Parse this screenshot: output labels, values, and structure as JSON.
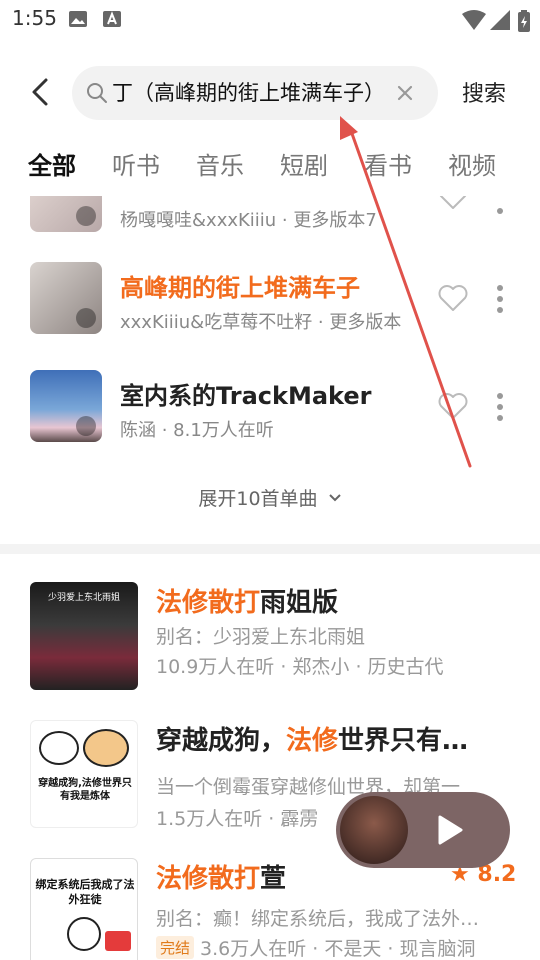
{
  "status_bar": {
    "time": "1:55",
    "icons": [
      "image-icon",
      "a-box-icon",
      "wifi-icon",
      "signal-icon",
      "battery-icon"
    ]
  },
  "search": {
    "query": "丁（高峰期的街上堆满车子）",
    "button_label": "搜索"
  },
  "tabs": [
    {
      "label": "全部",
      "active": true
    },
    {
      "label": "听书"
    },
    {
      "label": "音乐"
    },
    {
      "label": "短剧"
    },
    {
      "label": "看书"
    },
    {
      "label": "视频"
    }
  ],
  "songs": [
    {
      "title": "",
      "subtitle": "杨嘎嘎哇&xxxKiiiu · 更多版本7"
    },
    {
      "title": "高峰期的街上堆满车子",
      "subtitle": "xxxKiiiu&吃草莓不吐籽 · 更多版本",
      "highlight": true
    },
    {
      "title": "室内系的TrackMaker",
      "subtitle": "陈涵 · 8.1万人在听"
    }
  ],
  "expand_label": "展开10首单曲",
  "books": [
    {
      "title_hl": "法修散打",
      "title_rest": "雨姐版",
      "line1": "别名：少羽爱上东北雨姐",
      "line2": "10.9万人在听 · 郑杰小 · 历史古代",
      "cover_text": "少羽爱上东北雨姐"
    },
    {
      "title_pre": "穿越成狗，",
      "title_hl": "法修",
      "title_rest": "世界只有我是",
      "line1": "当一个倒霉蛋穿越修仙世界，却第一",
      "line2": "1.5万人在听 · 霹雳",
      "cover_text": "穿越成狗,法修世界只有我是炼体"
    },
    {
      "title_hl": "法修散打",
      "title_rest": "萱",
      "rating": "8.2",
      "line1": "别名：癫！绑定系统后，我成了法外狂徒",
      "badge": "完结",
      "line2": "3.6万人在听 · 不是天 · 现言脑洞",
      "cover_text": "绑定系统后我成了法外狂徒"
    }
  ],
  "colors": {
    "accent": "#f26b1d",
    "annotation_arrow": "#e0524b",
    "player_bg": "#7d6565"
  }
}
